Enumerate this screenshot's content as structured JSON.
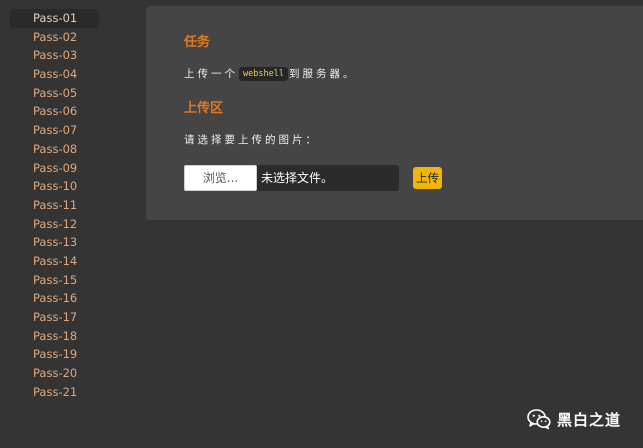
{
  "sidebar": {
    "items": [
      {
        "label": "Pass-01"
      },
      {
        "label": "Pass-02"
      },
      {
        "label": "Pass-03"
      },
      {
        "label": "Pass-04"
      },
      {
        "label": "Pass-05"
      },
      {
        "label": "Pass-06"
      },
      {
        "label": "Pass-07"
      },
      {
        "label": "Pass-08"
      },
      {
        "label": "Pass-09"
      },
      {
        "label": "Pass-10"
      },
      {
        "label": "Pass-11"
      },
      {
        "label": "Pass-12"
      },
      {
        "label": "Pass-13"
      },
      {
        "label": "Pass-14"
      },
      {
        "label": "Pass-15"
      },
      {
        "label": "Pass-16"
      },
      {
        "label": "Pass-17"
      },
      {
        "label": "Pass-18"
      },
      {
        "label": "Pass-19"
      },
      {
        "label": "Pass-20"
      },
      {
        "label": "Pass-21"
      }
    ],
    "active_item": "Pass-01"
  },
  "task": {
    "heading": "任务",
    "text_before": "上传一个",
    "code": "webshell",
    "text_after": "到服务器。"
  },
  "upload": {
    "heading": "上传区",
    "prompt": "请选择要上传的图片：",
    "browse_label": "浏览...",
    "file_status": "未选择文件。",
    "submit_label": "上传"
  },
  "watermark": {
    "text": "黑白之道",
    "icon": "wechat-icon"
  },
  "colors": {
    "background": "#343434",
    "panel": "#454545",
    "heading": "#e5771e",
    "sidebar_link": "#e3a67a",
    "code_text": "#e8d44d",
    "submit_button": "#f1b60c"
  }
}
